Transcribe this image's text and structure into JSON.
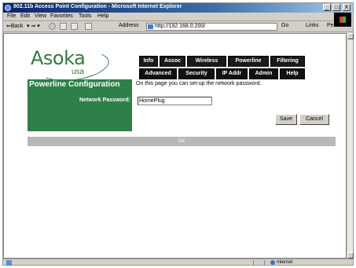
{
  "window": {
    "title": "802.11b Access Point Configuration - Microsoft Internet Explorer",
    "minimize": "_",
    "maximize": "□",
    "close": "X"
  },
  "menu": [
    "File",
    "Edit",
    "View",
    "Favorites",
    "Tools",
    "Help"
  ],
  "toolbar": {
    "back_label": "⇐Back",
    "forward_arrows": "▾ ⇒ ▾",
    "address_label": "Address",
    "address_value": "http://192.168.0.200/",
    "go_label": "Go",
    "links_label": "Links",
    "person_label": "Person"
  },
  "logo": {
    "brand": "Asoka",
    "suffix": "usa"
  },
  "tabs_row1": [
    "Info",
    "Assoc",
    "Wireless",
    "Powerline",
    "Filtering"
  ],
  "tabs_row2": [
    "Advanced",
    "Security",
    "IP Addr",
    "Admin",
    "Help"
  ],
  "page": {
    "heading": "Powerline Configuration",
    "description": "On this page you can set-up the network password.",
    "password_label": "Network Password:",
    "password_value": "HomePlug",
    "save_label": "Save",
    "cancel_label": "Cancel",
    "status_text": "OK"
  },
  "statusbar": {
    "zone": "Internet"
  },
  "colors": {
    "brand_green": "#2e8049",
    "tab_bg": "#1a1a1a"
  }
}
